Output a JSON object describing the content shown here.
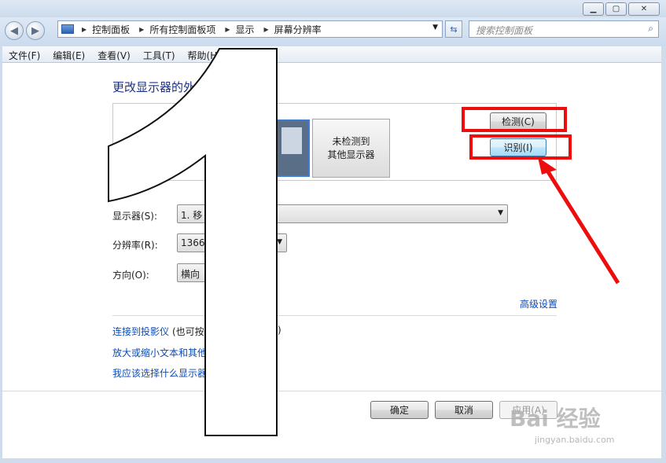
{
  "breadcrumb": [
    "控制面板",
    "所有控制面板项",
    "显示",
    "屏幕分辨率"
  ],
  "search": {
    "placeholder": "搜索控制面板"
  },
  "menu": [
    "文件(F)",
    "编辑(E)",
    "查看(V)",
    "工具(T)",
    "帮助(H)"
  ],
  "heading": "更改显示器的外",
  "preview": {
    "monitor2_line1": "未检测到",
    "monitor2_line2": "其他显示器"
  },
  "buttons": {
    "detect": "检测(C)",
    "identify": "识别(I)",
    "ok": "确定",
    "cancel": "取消",
    "apply": "应用(A)"
  },
  "fields": {
    "display_label": "显示器(S):",
    "display_value": "1. 移",
    "resolution_label": "分辨率(R):",
    "resolution_value": "1366",
    "orientation_label": "方向(O):",
    "orientation_value": "横向"
  },
  "links": {
    "advanced": "高级设置",
    "projector": "连接到投影仪",
    "projector_tail_start": " (也可按",
    "projector_tail_end": ")",
    "enlarge": "放大或缩小文本和其他",
    "which_display": "我应该选择什么显示器"
  },
  "overlay": {
    "digit": "1"
  },
  "watermark": {
    "brand": "Bai 经验",
    "url": "jingyan.baidu.com"
  }
}
